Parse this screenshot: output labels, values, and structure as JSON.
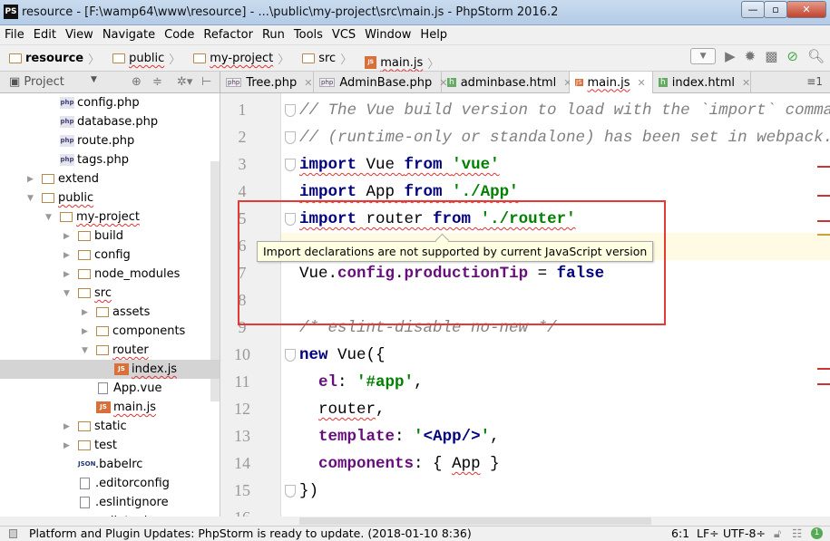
{
  "window": {
    "title": "resource - [F:\\wamp64\\www\\resource] - ...\\public\\my-project\\src\\main.js - PhpStorm 2016.2",
    "logo": "PS",
    "controls": [
      "—",
      "▫",
      "✕"
    ]
  },
  "menu": [
    "File",
    "Edit",
    "View",
    "Navigate",
    "Code",
    "Refactor",
    "Run",
    "Tools",
    "VCS",
    "Window",
    "Help"
  ],
  "breadcrumb": [
    "resource",
    "public",
    "my-project",
    "src",
    "main.js"
  ],
  "project_panel": {
    "label": "Project"
  },
  "tabs": [
    {
      "label": "Tree.php",
      "icon": "php"
    },
    {
      "label": "AdminBase.php",
      "icon": "php"
    },
    {
      "label": "adminbase.html",
      "icon": "html"
    },
    {
      "label": "main.js",
      "icon": "js",
      "active": true
    },
    {
      "label": "index.html",
      "icon": "html"
    }
  ],
  "tab_overflow": "≡1",
  "tree": [
    {
      "label": "config.php",
      "depth": 1,
      "icon": "php"
    },
    {
      "label": "database.php",
      "depth": 1,
      "icon": "php"
    },
    {
      "label": "route.php",
      "depth": 1,
      "icon": "php"
    },
    {
      "label": "tags.php",
      "depth": 1,
      "icon": "php"
    },
    {
      "label": "extend",
      "depth": 0,
      "icon": "folder",
      "arrow": "right"
    },
    {
      "label": "public",
      "depth": 0,
      "icon": "folder",
      "arrow": "down"
    },
    {
      "label": "my-project",
      "depth": 1,
      "icon": "folder",
      "arrow": "down"
    },
    {
      "label": "build",
      "depth": 2,
      "icon": "folder",
      "arrow": "right"
    },
    {
      "label": "config",
      "depth": 2,
      "icon": "folder",
      "arrow": "right"
    },
    {
      "label": "node_modules",
      "depth": 2,
      "icon": "folder",
      "arrow": "right"
    },
    {
      "label": "src",
      "depth": 2,
      "icon": "folder",
      "arrow": "down"
    },
    {
      "label": "assets",
      "depth": 3,
      "icon": "folder",
      "arrow": "right"
    },
    {
      "label": "components",
      "depth": 3,
      "icon": "folder",
      "arrow": "right"
    },
    {
      "label": "router",
      "depth": 3,
      "icon": "folder",
      "arrow": "down"
    },
    {
      "label": "index.js",
      "depth": 4,
      "icon": "js",
      "selected": true
    },
    {
      "label": "App.vue",
      "depth": 3,
      "icon": "file"
    },
    {
      "label": "main.js",
      "depth": 3,
      "icon": "js"
    },
    {
      "label": "static",
      "depth": 2,
      "icon": "folder",
      "arrow": "right"
    },
    {
      "label": "test",
      "depth": 2,
      "icon": "folder",
      "arrow": "right"
    },
    {
      "label": ".babelrc",
      "depth": 2,
      "icon": "json"
    },
    {
      "label": ".editorconfig",
      "depth": 2,
      "icon": "file"
    },
    {
      "label": ".eslintignore",
      "depth": 2,
      "icon": "file"
    },
    {
      "label": ".eslintrc.js",
      "depth": 2,
      "icon": "eslint"
    }
  ],
  "code": [
    [
      [
        "comment",
        "// The Vue build version to load with the `import` command"
      ]
    ],
    [
      [
        "comment",
        "// (runtime-only or standalone) has been set in webpack.base.conf"
      ]
    ],
    [
      [
        "kw sq",
        "import"
      ],
      [
        "plain sq",
        " Vue "
      ],
      [
        "kw sq",
        "from"
      ],
      [
        "plain sq",
        " "
      ],
      [
        "str sq",
        "'vue'"
      ]
    ],
    [
      [
        "kw sq",
        "import"
      ],
      [
        "plain sq",
        " App "
      ],
      [
        "kw sq",
        "from"
      ],
      [
        "plain sq",
        " "
      ],
      [
        "str sq",
        "'./App'"
      ]
    ],
    [
      [
        "kw sq",
        "import"
      ],
      [
        "plain sq",
        " router "
      ],
      [
        "kw sq",
        "from"
      ],
      [
        "plain sq",
        " "
      ],
      [
        "str sq",
        "'./router'"
      ]
    ],
    [],
    [
      [
        "plain",
        "Vue."
      ],
      [
        "prop",
        "config"
      ],
      [
        "plain",
        "."
      ],
      [
        "prop",
        "productionTip"
      ],
      [
        "plain",
        " = "
      ],
      [
        "kw",
        "false"
      ]
    ],
    [],
    [
      [
        "comment",
        "/* eslint-disable no-new */"
      ]
    ],
    [
      [
        "kw",
        "new"
      ],
      [
        "plain",
        " Vue({"
      ]
    ],
    [
      [
        "plain",
        "  "
      ],
      [
        "prop",
        "el"
      ],
      [
        "plain",
        ": "
      ],
      [
        "str",
        "'#app'"
      ],
      [
        "plain",
        ","
      ]
    ],
    [
      [
        "plain",
        "  "
      ],
      [
        "plain sq",
        "router"
      ],
      [
        "plain",
        ","
      ]
    ],
    [
      [
        "plain",
        "  "
      ],
      [
        "prop",
        "template"
      ],
      [
        "plain",
        ": "
      ],
      [
        "str",
        "'"
      ],
      [
        "kw",
        "<App/>"
      ],
      [
        "str",
        "'"
      ],
      [
        "plain",
        ","
      ]
    ],
    [
      [
        "plain",
        "  "
      ],
      [
        "prop",
        "components"
      ],
      [
        "plain",
        ": { "
      ],
      [
        "plain sq",
        "App"
      ],
      [
        "plain",
        " }"
      ]
    ],
    [
      [
        "plain",
        "})"
      ]
    ],
    []
  ],
  "tooltip": "Import declarations are not supported by current JavaScript version",
  "status": {
    "message": "Platform and Plugin Updates: PhpStorm is ready to update. (2018-01-10 8:36)",
    "position": "6:1",
    "line_sep": "LF÷",
    "encoding": "UTF-8÷",
    "notifications": "1"
  },
  "colors": {
    "keyword": "#000080",
    "string": "#008000",
    "property": "#660e7a",
    "comment": "#808080",
    "highlight_box": "#e53935"
  }
}
